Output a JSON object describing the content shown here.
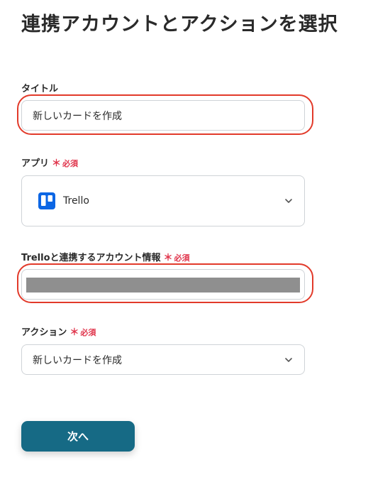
{
  "page": {
    "title": "連携アカウントとアクションを選択"
  },
  "fields": {
    "title_field": {
      "label": "タイトル",
      "value": "新しいカードを作成"
    },
    "app_field": {
      "label": "アプリ",
      "required_mark": "＊",
      "required_text": "必須",
      "value": "Trello",
      "logo_icon": "trello-logo-icon",
      "logo_color": "#0c66e4"
    },
    "account_field": {
      "label": "Trelloと連携するアカウント情報",
      "required_mark": "＊",
      "required_text": "必須"
    },
    "action_field": {
      "label": "アクション",
      "required_mark": "＊",
      "required_text": "必須",
      "value": "新しいカードを作成"
    }
  },
  "buttons": {
    "next_label": "次へ"
  },
  "colors": {
    "highlight": "#e23a2a",
    "required": "#e0344b",
    "primary_button": "#166a85"
  }
}
